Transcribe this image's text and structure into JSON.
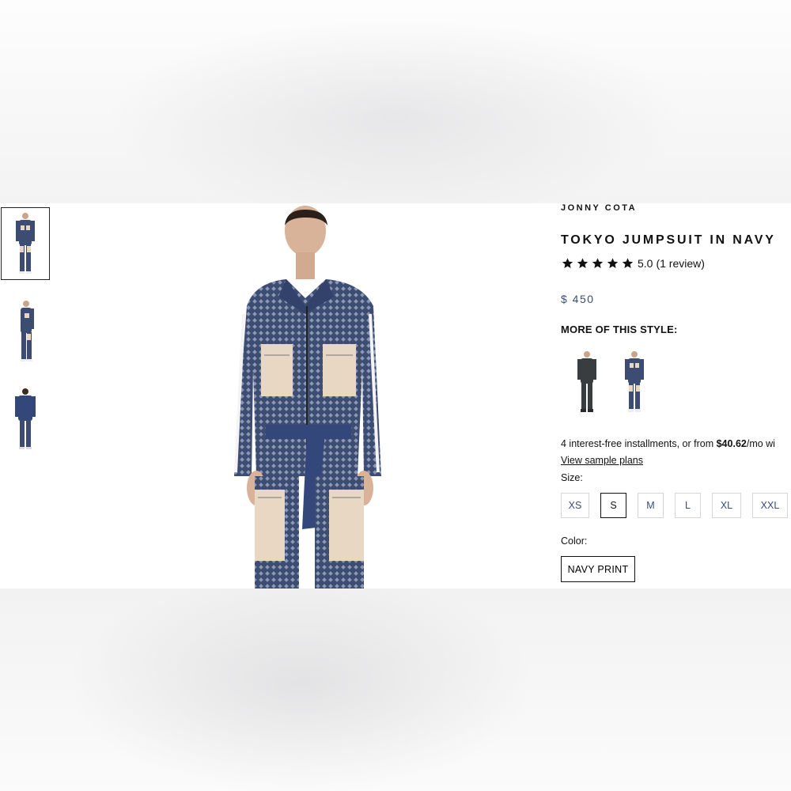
{
  "product": {
    "brand": "JONNY COTA",
    "title": "TOKYO JUMPSUIT IN NAVY",
    "rating_value": "5.0",
    "review_count": "(1 review)",
    "price": "$ 450"
  },
  "more_styles": {
    "heading": "MORE OF THIS STYLE:",
    "items": [
      {
        "name": "charcoal-jumpsuit-swatch",
        "icon": "model-figure"
      },
      {
        "name": "navy-jumpsuit-swatch",
        "icon": "model-figure"
      }
    ]
  },
  "installments": {
    "prefix": "4 interest-free installments, or from ",
    "amount": "$40.62",
    "suffix": "/mo wi",
    "link": "View sample plans"
  },
  "size": {
    "label": "Size:",
    "options": [
      "XS",
      "S",
      "M",
      "L",
      "XL",
      "XXL"
    ],
    "selected": "S"
  },
  "color": {
    "label": "Color:",
    "selected": "NAVY PRINT"
  },
  "colors": {
    "navy": "#3d4c73",
    "beige": "#e8d8c3",
    "belt": "#33477a",
    "price": "#3b4c78",
    "charcoal": "#3a3d3f"
  }
}
